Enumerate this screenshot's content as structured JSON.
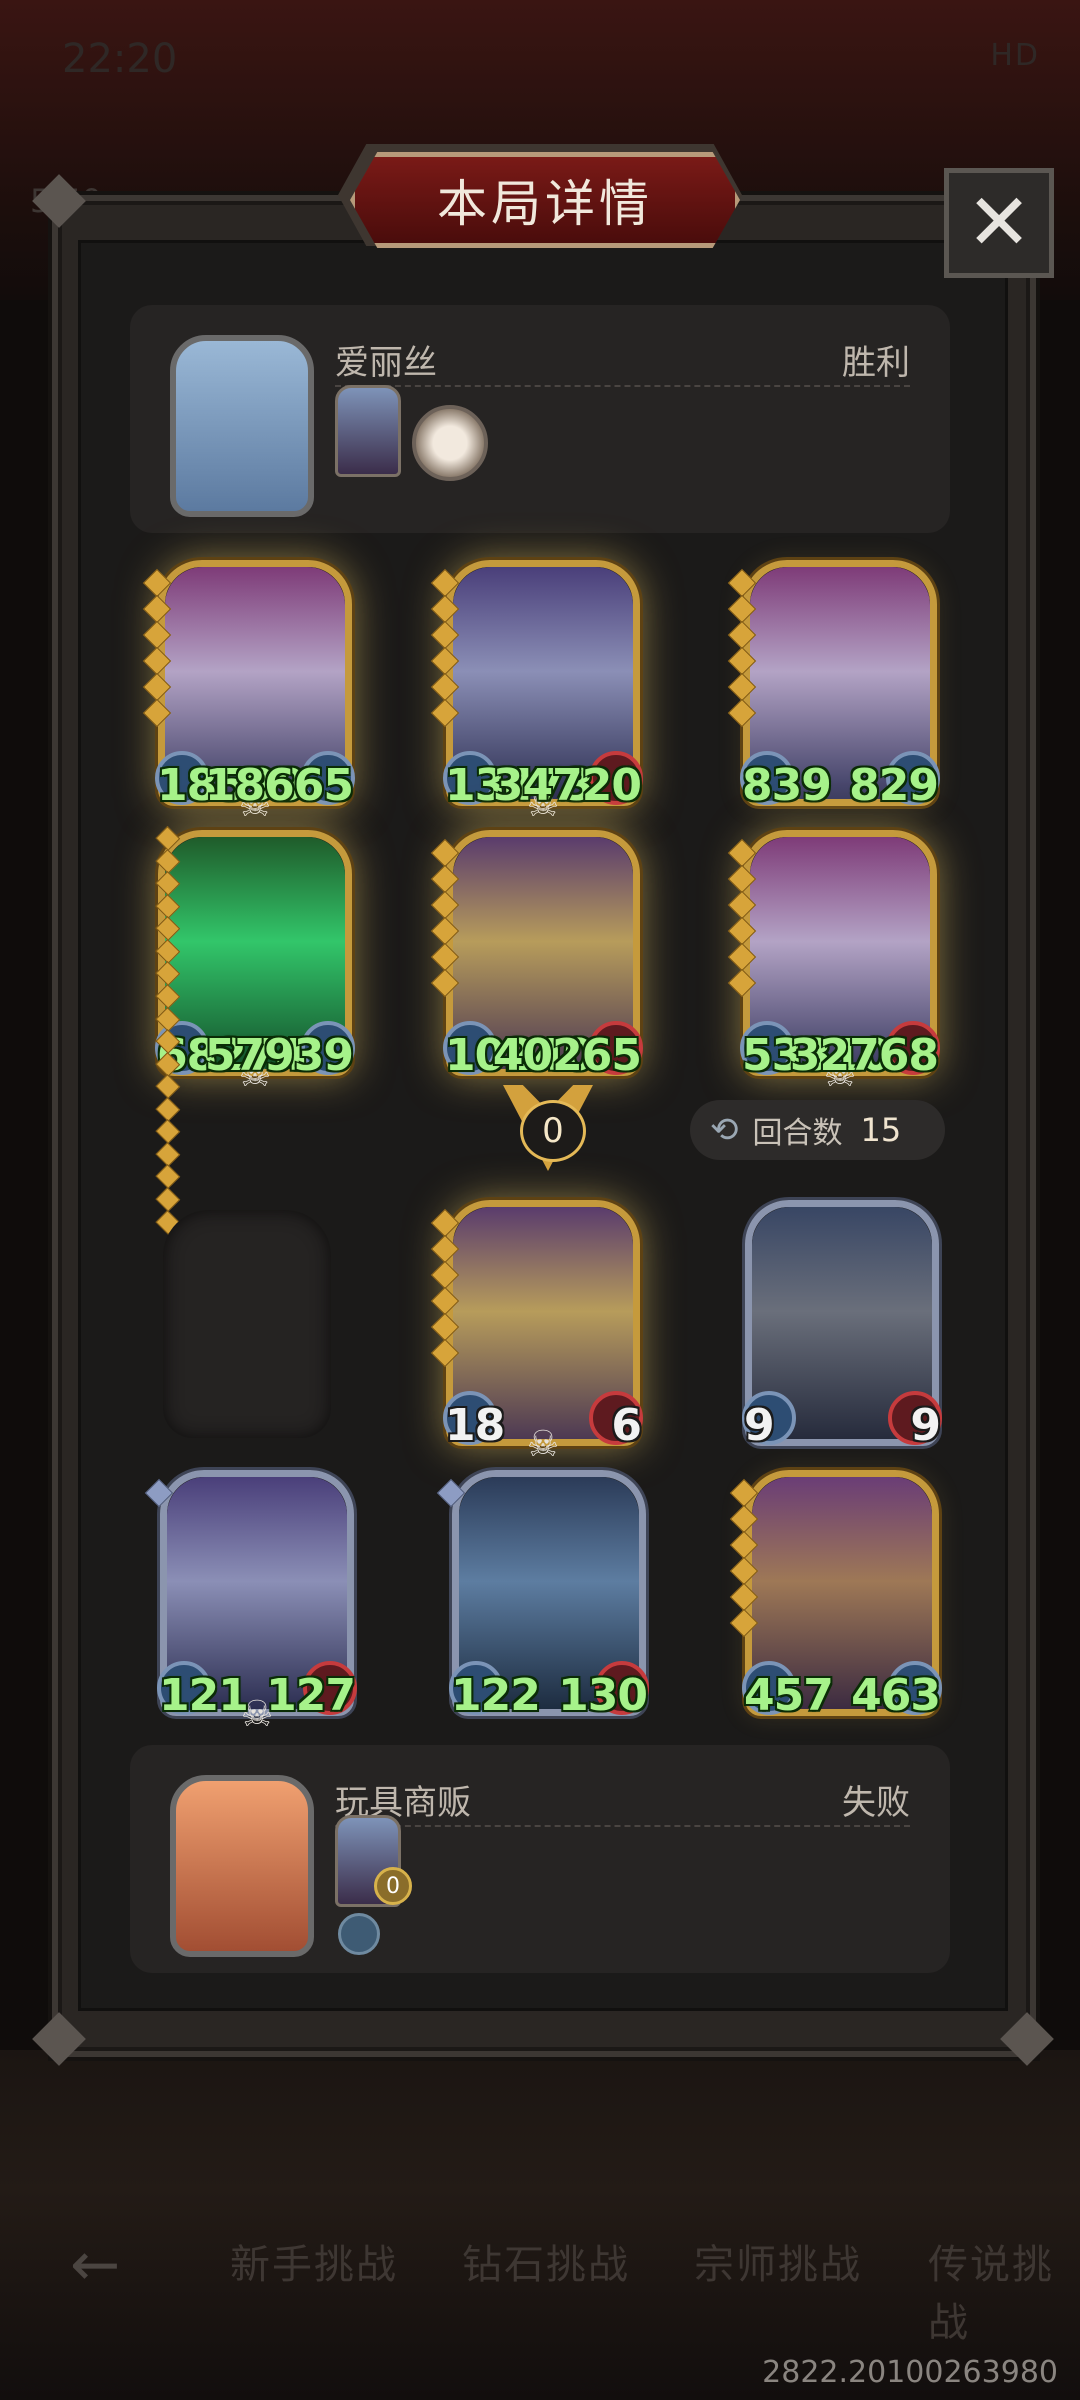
{
  "status_bar": {
    "time": "22:20",
    "right": "HD",
    "left_count": "5/50"
  },
  "dialog": {
    "title": "本局详情",
    "close_symbol": "✕"
  },
  "players": [
    {
      "name": "爱丽丝",
      "result": "胜利"
    },
    {
      "name": "玩具商贩",
      "result": "失败",
      "mini_badge": "0"
    }
  ],
  "board_top": [
    {
      "atk": "18599",
      "hp": "18665"
    },
    {
      "atk": "13473",
      "hp": "34720"
    },
    {
      "atk": "839",
      "hp": "829"
    },
    {
      "atk": "68274",
      "hp": "57939"
    },
    {
      "atk": "10240",
      "hp": "40265"
    },
    {
      "atk": "53310",
      "hp": "32768"
    }
  ],
  "marker_value": "0",
  "turns": {
    "label": "回合数",
    "value": "15"
  },
  "board_mid": [
    {
      "atk": "18",
      "hp": "6"
    },
    {
      "atk": "9",
      "hp": "9"
    }
  ],
  "board_bottom": [
    {
      "atk": "121",
      "hp": "127"
    },
    {
      "atk": "122",
      "hp": "130"
    },
    {
      "atk": "457",
      "hp": "463"
    }
  ],
  "nav": {
    "back": "←",
    "items": [
      "新手挑战",
      "钻石挑战",
      "宗师挑战",
      "传说挑战"
    ]
  },
  "version": "2822.20100263980"
}
